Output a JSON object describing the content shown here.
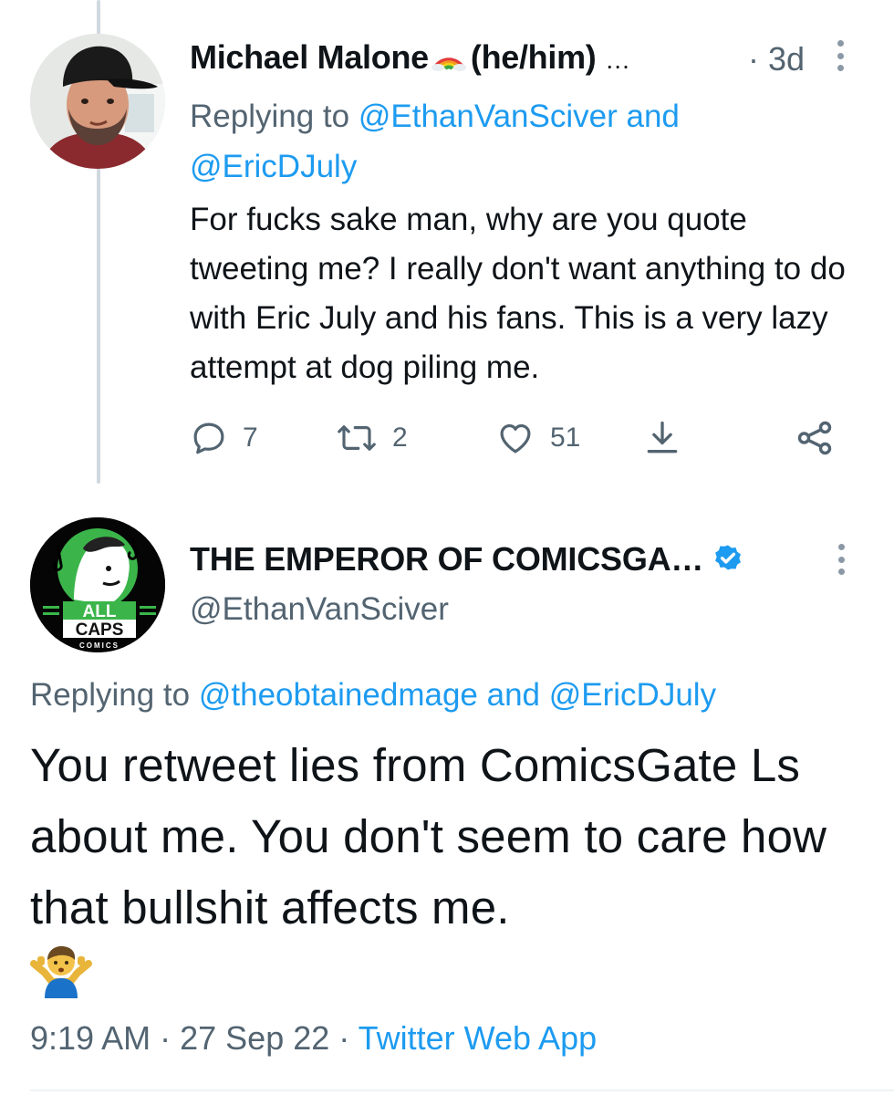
{
  "reply_tweet": {
    "display_name": "Michael Malone",
    "pronouns": "(he/him)",
    "name_ellipsis": "…",
    "time_ago": "· 3d",
    "replying_prefix": "Replying to",
    "replying_user1": "@EthanVanSciver",
    "replying_and": "and",
    "replying_user2": "@EricDJuly",
    "text": "For fucks sake man, why are you quote tweeting me? I really don't want anything to do with Eric July and his fans. This is a very lazy attempt at dog piling me.",
    "stats": {
      "replies": "7",
      "retweets": "2",
      "likes": "51"
    },
    "icons": [
      "reply-icon",
      "retweet-icon",
      "like-icon",
      "download-icon",
      "share-icon",
      "more-icon"
    ]
  },
  "main_tweet": {
    "display_name": "THE EMPEROR OF COMICSGA…",
    "handle": "@EthanVanSciver",
    "avatar_text_top": "ALL",
    "avatar_text_mid": "CAPS",
    "avatar_text_bottom": "COMICS",
    "replying_prefix": "Replying to",
    "replying_user1": "@theobtainedmage",
    "replying_and": "and",
    "replying_user2": "@EricDJuly",
    "text": "You retweet lies from ComicsGate Ls about me.  You don't seem to care how that bullshit affects me.",
    "emoji_icon": "person-shrugging-icon",
    "time": "9:19 AM",
    "date": "27 Sep 22",
    "source": "Twitter Web App",
    "separator": "·"
  },
  "colors": {
    "link": "#1d9bf0",
    "secondary_text": "#536471",
    "primary_text": "#0f1419",
    "verified": "#1d9bf0",
    "avatar_brand_green": "#3bb54a"
  }
}
